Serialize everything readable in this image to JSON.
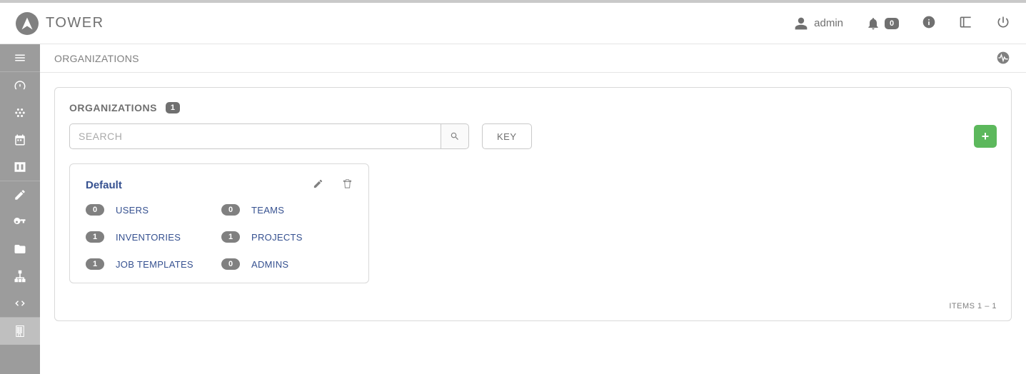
{
  "brand": {
    "name": "TOWER"
  },
  "topbar": {
    "username": "admin",
    "notification_count": "0"
  },
  "page": {
    "title": "ORGANIZATIONS"
  },
  "panel": {
    "title": "ORGANIZATIONS",
    "count": "1",
    "search_placeholder": "SEARCH",
    "key_button": "KEY"
  },
  "org": {
    "name": "Default",
    "links": {
      "users": {
        "label": "USERS",
        "count": "0"
      },
      "teams": {
        "label": "TEAMS",
        "count": "0"
      },
      "inventories": {
        "label": "INVENTORIES",
        "count": "1"
      },
      "projects": {
        "label": "PROJECTS",
        "count": "1"
      },
      "job_templates": {
        "label": "JOB TEMPLATES",
        "count": "1"
      },
      "admins": {
        "label": "ADMINS",
        "count": "0"
      }
    }
  },
  "footer": {
    "items_text": "ITEMS  1 – 1"
  }
}
